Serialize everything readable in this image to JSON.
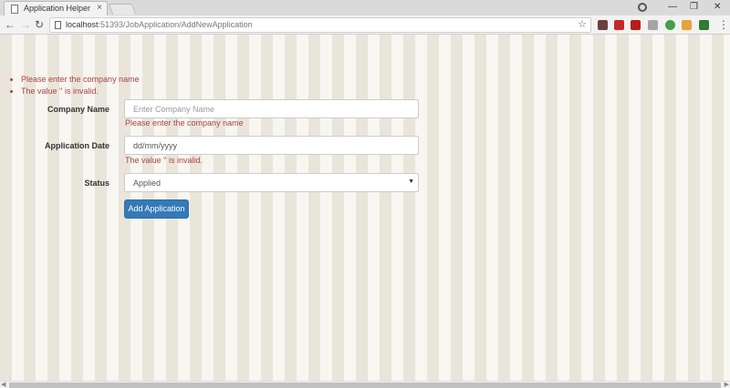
{
  "browser": {
    "tab_title": "Application Helper",
    "tab_close": "×",
    "url_host": "localhost",
    "url_path": ":51393/JobApplication/AddNewApplication",
    "window_controls": {
      "minimize": "—",
      "restore": "❐",
      "close": "✕"
    },
    "nav": {
      "back": "←",
      "forward": "→",
      "reload": "↻"
    },
    "bookmark_star": "☆",
    "menu": "⋮",
    "extensions": [
      {
        "name": "puzzle-extension-icon",
        "color": "#6b3f3f"
      },
      {
        "name": "red-ext-icon",
        "color": "#c62828"
      },
      {
        "name": "shield-ext-icon",
        "color": "#b71c1c"
      },
      {
        "name": "pdf-ext-icon",
        "color": "#a5a5a5"
      },
      {
        "name": "green-circle-ext-icon",
        "color": "#43a047"
      },
      {
        "name": "tag-ext-icon",
        "color": "#e6a23c"
      },
      {
        "name": "plus-ext-icon",
        "color": "#2e7d32"
      }
    ]
  },
  "validation_summary": [
    "Please enter the company name",
    "The value '' is invalid."
  ],
  "form": {
    "company_name": {
      "label": "Company Name",
      "placeholder": "Enter Company Name",
      "error": "Please enter the company name"
    },
    "application_date": {
      "label": "Application Date",
      "value": "dd/mm/yyyy",
      "error": "The value '' is invalid."
    },
    "status": {
      "label": "Status",
      "selected": "Applied"
    },
    "submit_label": "Add Application"
  },
  "colors": {
    "error": "#a94442",
    "primary": "#337ab7",
    "stripe_dark": "#e9e5da",
    "stripe_light": "#f8f6f1"
  }
}
